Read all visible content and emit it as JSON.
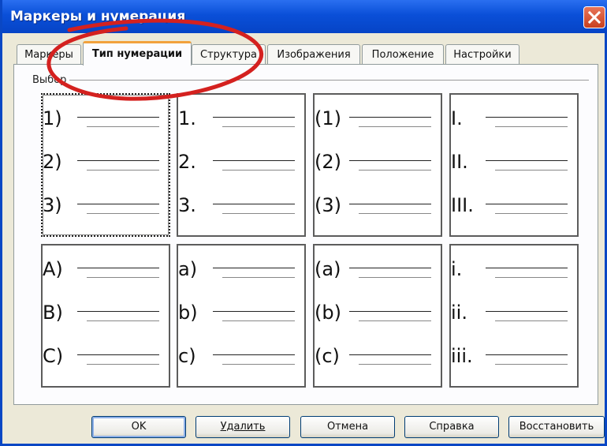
{
  "window": {
    "title": "Маркеры и нумерация"
  },
  "tabs": [
    {
      "label": "Маркеры"
    },
    {
      "label": "Тип нумерации",
      "active": true
    },
    {
      "label": "Структура"
    },
    {
      "label": "Изображения"
    },
    {
      "label": "Положение"
    },
    {
      "label": "Настройки"
    }
  ],
  "group": {
    "label": "Выбор"
  },
  "styles": [
    {
      "labels": [
        "1)",
        "2)",
        "3)"
      ],
      "selected": true
    },
    {
      "labels": [
        "1.",
        "2.",
        "3."
      ]
    },
    {
      "labels": [
        "(1)",
        "(2)",
        "(3)"
      ]
    },
    {
      "labels": [
        "I.",
        "II.",
        "III."
      ]
    },
    {
      "labels": [
        "A)",
        "B)",
        "C)"
      ]
    },
    {
      "labels": [
        "a)",
        "b)",
        "c)"
      ]
    },
    {
      "labels": [
        "(a)",
        "(b)",
        "(c)"
      ]
    },
    {
      "labels": [
        "i.",
        "ii.",
        "iii."
      ]
    }
  ],
  "buttons": {
    "ok": "OK",
    "delete": "Удалить",
    "cancel": "Отмена",
    "help": "Справка",
    "reset": "Восстановить"
  },
  "colors": {
    "titlebar": "#0a4fd8",
    "active_tab_accent": "#f2a23c",
    "annotation": "#d4211f"
  }
}
